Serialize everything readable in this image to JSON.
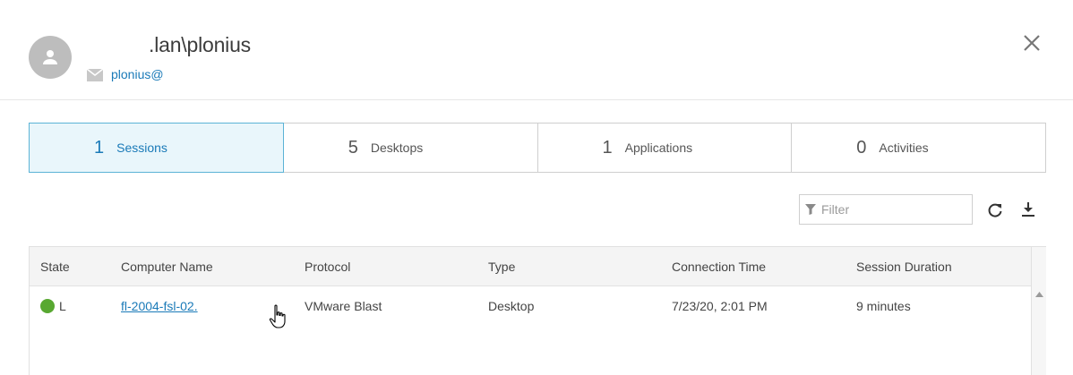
{
  "header": {
    "user_name": ".lan\\plonius",
    "user_email": "plonius@"
  },
  "tabs": [
    {
      "count": "1",
      "label": "Sessions",
      "active": true
    },
    {
      "count": "5",
      "label": "Desktops",
      "active": false
    },
    {
      "count": "1",
      "label": "Applications",
      "active": false
    },
    {
      "count": "0",
      "label": "Activities",
      "active": false
    }
  ],
  "toolbar": {
    "filter_placeholder": "Filter"
  },
  "grid": {
    "columns": [
      "State",
      "Computer Name",
      "Protocol",
      "Type",
      "Connection Time",
      "Session Duration"
    ],
    "rows": [
      {
        "state": "L",
        "state_color": "#58a831",
        "computer_name": "fl-2004-fsl-02.",
        "protocol": "VMware Blast",
        "type": "Desktop",
        "connection_time": "7/23/20, 2:01 PM",
        "session_duration": "9 minutes"
      }
    ]
  },
  "colors": {
    "accent": "#1a7ab8",
    "active_tab_bg": "#e9f6fb",
    "active_tab_border": "#5bb3d6",
    "status_green": "#58a831"
  },
  "icons": [
    "user-avatar-icon",
    "mail-icon",
    "close-icon",
    "filter-icon",
    "refresh-icon",
    "download-icon",
    "scroll-up-icon",
    "hand-cursor-icon"
  ]
}
